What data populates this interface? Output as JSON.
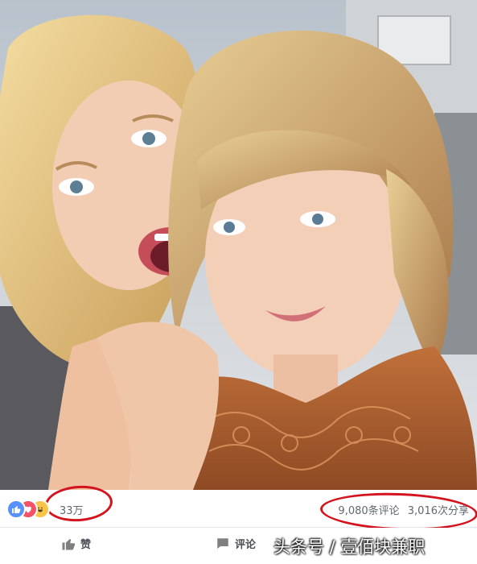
{
  "reactions": {
    "icons": [
      "like-icon",
      "love-icon",
      "haha-icon"
    ],
    "count": "33万",
    "comments": "9,080条评论",
    "shares": "3,016次分享"
  },
  "actions": {
    "like_label": "赞",
    "comment_label": "评论"
  },
  "watermark": "头条号 / 壹佰块兼职",
  "colors": {
    "annotation_red": "#d3141e",
    "like_blue": "#5890ff",
    "love_red": "#f25268",
    "haha_yellow": "#f7c54a",
    "text_gray": "#616770"
  }
}
